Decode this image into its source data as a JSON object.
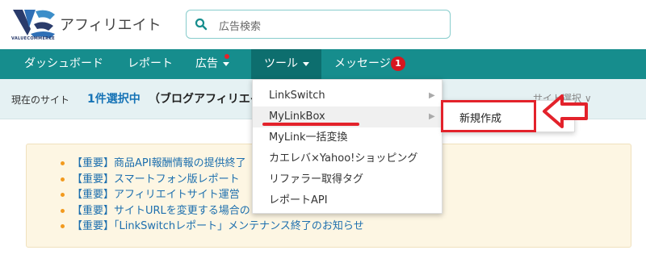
{
  "brand": {
    "name": "アフィリエイト",
    "logo_sub": "VALUECOMMERCE"
  },
  "search": {
    "placeholder": "広告検索"
  },
  "nav": {
    "items": [
      {
        "label": "ダッシュボード"
      },
      {
        "label": "レポート"
      },
      {
        "label": "広告"
      },
      {
        "label": "ツール"
      },
      {
        "label": "メッセージ"
      }
    ],
    "message_count": "1"
  },
  "sitebar": {
    "label": "現在のサイト",
    "count": "1件選択中",
    "site": "（ブログアフィリエイト",
    "select": "サイト選択 ∨"
  },
  "dropdown": {
    "items": [
      {
        "label": "LinkSwitch",
        "has_sub": true
      },
      {
        "label": "MyLinkBox",
        "has_sub": true
      },
      {
        "label": "MyLink一括変換",
        "has_sub": false
      },
      {
        "label": "カエレバ×Yahoo!ショッピング",
        "has_sub": false
      },
      {
        "label": "リファラー取得タグ",
        "has_sub": false
      },
      {
        "label": "レポートAPI",
        "has_sub": false
      }
    ]
  },
  "submenu": {
    "item": "新規作成"
  },
  "notices": [
    "【重要】商品API報酬情報の提供終了",
    "【重要】スマートフォン版レポート",
    "【重要】アフィリエイトサイト運営",
    "【重要】サイトURLを変更する場合の",
    "【重要】「LinkSwitchレポート」メンテナンス終了のお知らせ"
  ],
  "colors": {
    "nav": "#168d8d",
    "nav_active": "#0d6e6e",
    "accent_red": "#e3222b",
    "link": "#1d6fae"
  }
}
